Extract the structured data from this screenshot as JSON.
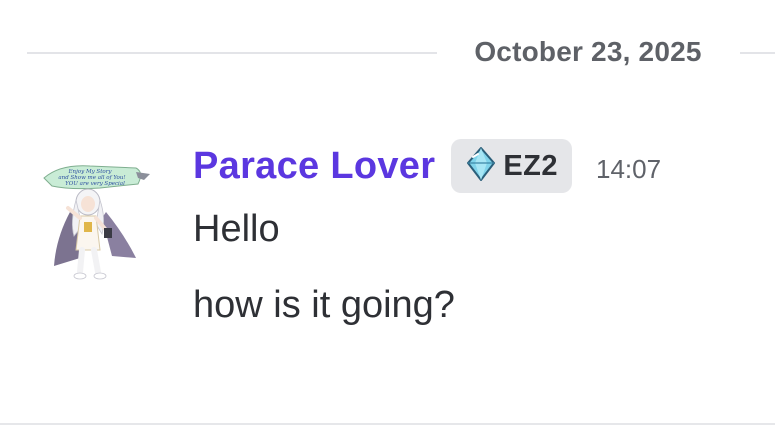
{
  "date_divider": {
    "label": "October 23, 2025"
  },
  "message": {
    "author": "Parace Lover",
    "author_color": "#5b37e0",
    "server_tag": {
      "icon": "diamond-icon",
      "label": "EZ2"
    },
    "timestamp": "14:07",
    "avatar": {
      "icon": "anime-character-avatar",
      "caption_lines": [
        "Enjoy My Story",
        "and Show me all of You!",
        "YOU are very Special"
      ]
    },
    "lines": [
      {
        "text": "Hello"
      },
      {
        "text": "how is it going?"
      }
    ]
  }
}
